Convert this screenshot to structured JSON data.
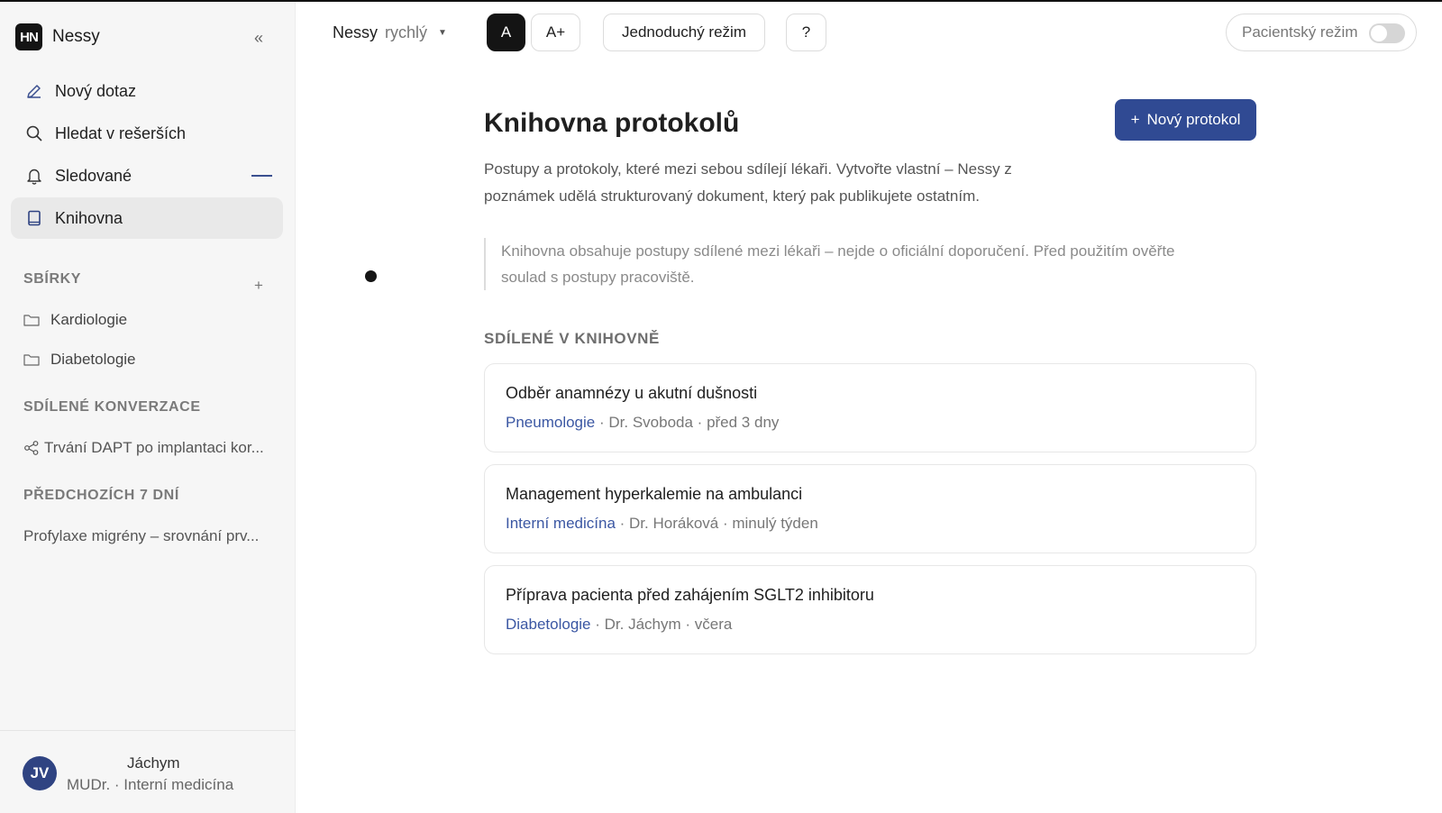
{
  "app": {
    "logo": "HN",
    "name": "Nessy"
  },
  "sidebar": {
    "nav": [
      {
        "label": "Nový dotaz",
        "icon": "pencil-icon"
      },
      {
        "label": "Hledat v rešerších",
        "icon": "search-icon"
      },
      {
        "label": "Sledované",
        "icon": "bell-icon"
      },
      {
        "label": "Knihovna",
        "icon": "book-icon",
        "active": true
      }
    ],
    "collections_title": "SBÍRKY",
    "collections": [
      {
        "label": "Kardiologie",
        "icon": "folder-icon"
      },
      {
        "label": "Diabetologie",
        "icon": "folder-icon"
      }
    ],
    "shared_title": "SDÍLENÉ KONVERZACE",
    "shared": [
      {
        "label": "Trvání DAPT po implantaci kor...",
        "icon": "share-icon"
      }
    ],
    "recent_title": "PŘEDCHOZÍCH 7 DNÍ",
    "recent": [
      {
        "label": "Profylaxe migrény – srovnání prv..."
      }
    ],
    "user": {
      "initials": "JV",
      "name": "Jáchym",
      "role": "MUDr. · Interní medicína"
    }
  },
  "topbar": {
    "model_name": "Nessy",
    "model_speed": "rychlý",
    "font_normal": "A",
    "font_large": "A+",
    "simple_mode": "Jednoduchý režim",
    "help": "?",
    "patient_mode": "Pacientský režim",
    "patient_mode_on": false
  },
  "main": {
    "title": "Knihovna protokolů",
    "new_button": "Nový protokol",
    "intro": "Postupy a protokoly, které mezi sebou sdílejí lékaři. Vytvořte vlastní – Nessy z poznámek udělá strukturovaný dokument, který pak publikujete ostatním.",
    "note": "Knihovna obsahuje postupy sdílené mezi lékaři – nejde o oficiální doporučení.  Před použitím ověřte soulad s postupy pracoviště.",
    "list_title": "SDÍLENÉ V KNIHOVNĚ",
    "protocols": [
      {
        "title": "Odběr anamnézy u akutní dušnosti",
        "category": "Pneumologie",
        "author": "Dr. Svoboda",
        "time": "před 3 dny"
      },
      {
        "title": "Management hyperkalemie na ambulanci",
        "category": "Interní medicína",
        "author": "Dr. Horáková",
        "time": "minulý týden"
      },
      {
        "title": "Příprava pacienta před zahájením SGLT2 inhibitoru",
        "category": "Diabetologie",
        "author": "Dr. Jáchym",
        "time": "včera"
      }
    ]
  },
  "colors": {
    "accent": "#304a93",
    "category": "#3b57a3",
    "sidebar_bg": "#f6f6f6"
  }
}
